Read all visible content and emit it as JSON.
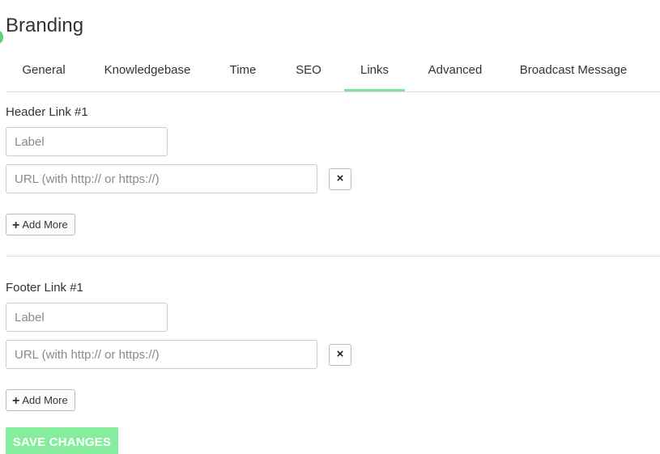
{
  "page": {
    "title": "Branding"
  },
  "tabs": [
    {
      "label": "General"
    },
    {
      "label": "Knowledgebase"
    },
    {
      "label": "Time"
    },
    {
      "label": "SEO"
    },
    {
      "label": "Links",
      "active": true
    },
    {
      "label": "Advanced"
    },
    {
      "label": "Broadcast Message"
    }
  ],
  "header_links": {
    "title": "Header Link #1",
    "label_placeholder": "Label",
    "url_placeholder": "URL (with http:// or https://)",
    "remove_glyph": "×",
    "add_more_label": "Add More"
  },
  "footer_links": {
    "title": "Footer Link #1",
    "label_placeholder": "Label",
    "url_placeholder": "URL (with http:// or https://)",
    "remove_glyph": "×",
    "add_more_label": "Add More"
  },
  "save_button": {
    "label": "SAVE CHANGES"
  },
  "colors": {
    "accent": "#7ee59a",
    "save_button": "#86ec9e"
  }
}
